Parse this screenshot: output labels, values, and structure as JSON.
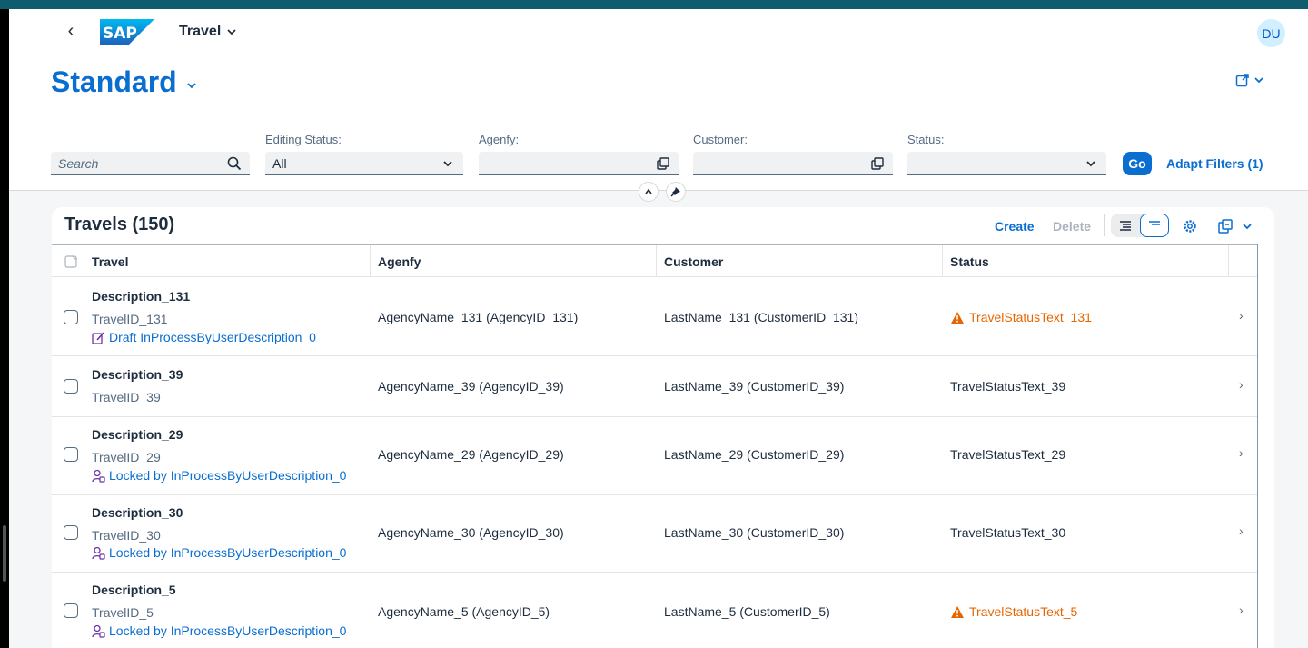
{
  "shell": {
    "app_title": "Travel",
    "avatar_initials": "DU"
  },
  "header": {
    "variant_title": "Standard"
  },
  "filters": {
    "search_placeholder": "Search",
    "editing_status_label": "Editing Status:",
    "editing_status_value": "All",
    "agency_label": "Agenfy:",
    "customer_label": "Customer:",
    "status_label": "Status:",
    "go_label": "Go",
    "adapt_label": "Adapt Filters (1)"
  },
  "table": {
    "title": "Travels (150)",
    "create_label": "Create",
    "delete_label": "Delete",
    "columns": [
      "Travel",
      "Agenfy",
      "Customer",
      "Status"
    ],
    "rows": [
      {
        "description": "Description_131",
        "travel_id": "TravelID_131",
        "state": "Draft InProcessByUserDescription_0",
        "state_type": "draft",
        "agency": "AgencyName_131 (AgencyID_131)",
        "customer": "LastName_131 (CustomerID_131)",
        "status": "TravelStatusText_131",
        "status_warning": true
      },
      {
        "description": "Description_39",
        "travel_id": "TravelID_39",
        "state": "",
        "state_type": "",
        "agency": "AgencyName_39 (AgencyID_39)",
        "customer": "LastName_39 (CustomerID_39)",
        "status": "TravelStatusText_39",
        "status_warning": false
      },
      {
        "description": "Description_29",
        "travel_id": "TravelID_29",
        "state": "Locked by InProcessByUserDescription_0",
        "state_type": "locked",
        "agency": "AgencyName_29 (AgencyID_29)",
        "customer": "LastName_29 (CustomerID_29)",
        "status": "TravelStatusText_29",
        "status_warning": false
      },
      {
        "description": "Description_30",
        "travel_id": "TravelID_30",
        "state": "Locked by InProcessByUserDescription_0",
        "state_type": "locked",
        "agency": "AgencyName_30 (AgencyID_30)",
        "customer": "LastName_30 (CustomerID_30)",
        "status": "TravelStatusText_30",
        "status_warning": false
      },
      {
        "description": "Description_5",
        "travel_id": "TravelID_5",
        "state": "Locked by InProcessByUserDescription_0",
        "state_type": "locked",
        "agency": "AgencyName_5 (AgencyID_5)",
        "customer": "LastName_5 (CustomerID_5)",
        "status": "TravelStatusText_5",
        "status_warning": true
      }
    ]
  },
  "colors": {
    "accent": "#0a6ed1",
    "warning": "#e76500",
    "text": "#1d2d3e"
  }
}
